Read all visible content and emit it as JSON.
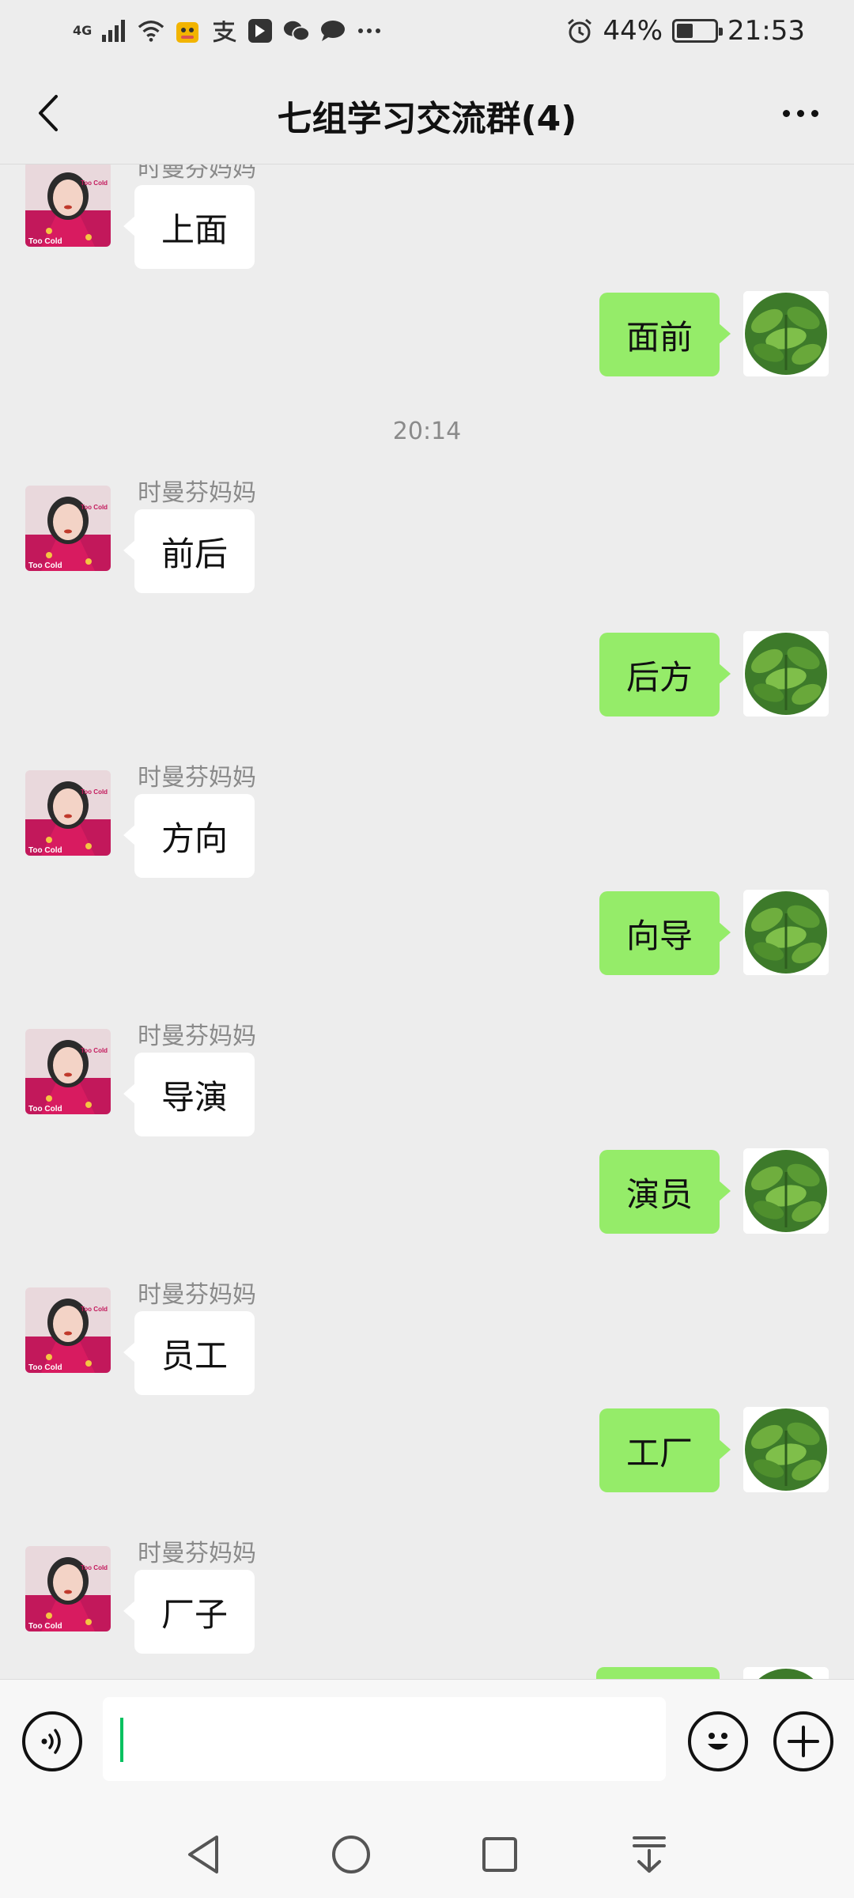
{
  "status_bar": {
    "network": "4G",
    "battery": "44%",
    "battery_level": 0.44,
    "time": "21:53",
    "left_icons": [
      "signal-icon",
      "wifi-icon",
      "app-notification-icon",
      "alipay-icon",
      "app-icon",
      "wechat-icon",
      "message-icon",
      "more-notifications-icon"
    ],
    "right_icons": [
      "alarm-icon",
      "battery-icon"
    ]
  },
  "header": {
    "title": "七组学习交流群(4)",
    "back_icon": "chevron-left-icon",
    "more_icon": "more-dots-icon"
  },
  "chat": {
    "messages": [
      {
        "side": "left",
        "sender": "时曼芬妈妈",
        "text": "上面"
      },
      {
        "side": "right",
        "text": "面前"
      },
      {
        "side": "left",
        "sender": "时曼芬妈妈",
        "text": "前后"
      },
      {
        "side": "right",
        "text": "后方"
      },
      {
        "side": "left",
        "sender": "时曼芬妈妈",
        "text": "方向"
      },
      {
        "side": "right",
        "text": "向导"
      },
      {
        "side": "left",
        "sender": "时曼芬妈妈",
        "text": "导演"
      },
      {
        "side": "right",
        "text": "演员"
      },
      {
        "side": "left",
        "sender": "时曼芬妈妈",
        "text": "员工"
      },
      {
        "side": "right",
        "text": "工厂"
      },
      {
        "side": "left",
        "sender": "时曼芬妈妈",
        "text": "厂子"
      }
    ],
    "timestamp": "20:14",
    "avatar_text": "Too Cold",
    "colors": {
      "outgoing_bubble": "#95ec69",
      "incoming_bubble": "#ffffff",
      "background": "#ededed"
    }
  },
  "input_bar": {
    "voice_icon": "voice-icon",
    "emoji_icon": "emoji-icon",
    "plus_icon": "plus-icon",
    "text_value": ""
  },
  "nav_bar": {
    "icons": [
      "back-triangle-icon",
      "home-circle-icon",
      "recents-square-icon",
      "hide-keyboard-icon"
    ]
  }
}
